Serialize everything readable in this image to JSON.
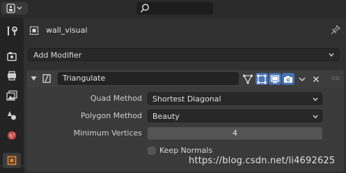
{
  "header": {
    "editor_type_icon": "properties-editor-icon",
    "search_icon": "search-icon",
    "search_value": ""
  },
  "tabs": [
    {
      "name": "tool-tab",
      "icon": "wrench-screwdriver-icon"
    },
    {
      "name": "render-tab",
      "icon": "camera-back-icon"
    },
    {
      "name": "output-tab",
      "icon": "printer-icon"
    },
    {
      "name": "view-layer-tab",
      "icon": "image-stack-icon"
    },
    {
      "name": "scene-tab",
      "icon": "scene-cone-sphere-icon"
    },
    {
      "name": "world-tab",
      "icon": "world-globe-icon"
    },
    {
      "name": "object-tab",
      "icon": "object-square-icon"
    }
  ],
  "object": {
    "name": "wall_visual"
  },
  "add_modifier": {
    "label": "Add Modifier"
  },
  "modifier": {
    "name": "Triangulate",
    "fields": {
      "quad_method": {
        "label": "Quad Method",
        "value": "Shortest Diagonal"
      },
      "polygon_method": {
        "label": "Polygon Method",
        "value": "Beauty"
      },
      "minimum_vertices": {
        "label": "Minimum Vertices",
        "value": "4"
      },
      "keep_normals": {
        "label": "Keep Normals",
        "checked": false
      }
    }
  },
  "watermark": "https://blog.csdn.net/li4692625",
  "colors": {
    "accent_blue": "#4772b3",
    "panel_bg": "#3a3a3a",
    "editor_bg": "#303030"
  }
}
